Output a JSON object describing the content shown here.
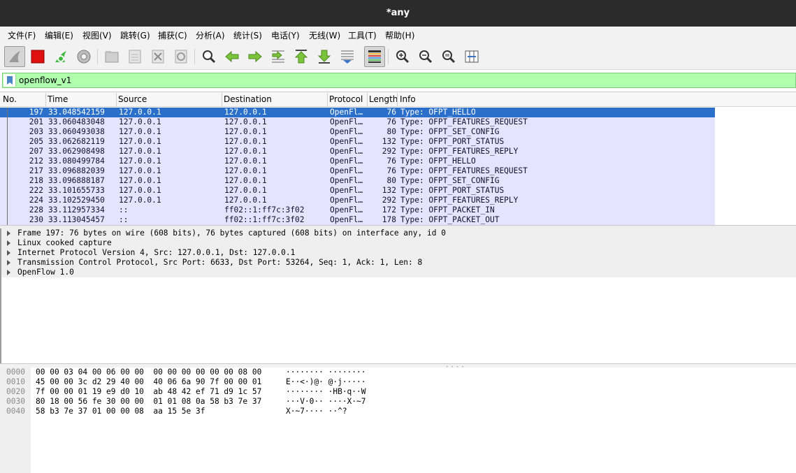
{
  "window": {
    "title": "*any"
  },
  "menu": [
    {
      "label": "文件(F)"
    },
    {
      "label": "编辑(E)"
    },
    {
      "label": "视图(V)"
    },
    {
      "label": "跳转(G)"
    },
    {
      "label": "捕获(C)"
    },
    {
      "label": "分析(A)"
    },
    {
      "label": "统计(S)"
    },
    {
      "label": "电话(Y)"
    },
    {
      "label": "无线(W)"
    },
    {
      "label": "工具(T)"
    },
    {
      "label": "帮助(H)"
    }
  ],
  "toolbar": {
    "icons": [
      "shark-fin-icon",
      "stop-capture-icon",
      "restart-capture-icon",
      "capture-options-icon",
      "open-file-icon",
      "save-file-icon",
      "close-file-icon",
      "reload-icon",
      "find-packet-icon",
      "go-back-icon",
      "go-forward-icon",
      "go-to-packet-icon",
      "go-first-icon",
      "go-last-icon",
      "auto-scroll-icon",
      "colorize-icon",
      "zoom-in-icon",
      "zoom-out-icon",
      "normal-size-icon",
      "resize-columns-icon"
    ]
  },
  "filter": {
    "value": "openflow_v1"
  },
  "packet_list": {
    "columns": [
      "No.",
      "Time",
      "Source",
      "Destination",
      "Protocol",
      "Length",
      "Info"
    ],
    "rows": [
      {
        "no": "197",
        "time": "33.048542159",
        "src": "127.0.0.1",
        "dst": "127.0.0.1",
        "proto": "OpenFl…",
        "len": "76",
        "info": "Type: OFPT_HELLO",
        "selected": true
      },
      {
        "no": "201",
        "time": "33.060483048",
        "src": "127.0.0.1",
        "dst": "127.0.0.1",
        "proto": "OpenFl…",
        "len": "76",
        "info": "Type: OFPT_FEATURES_REQUEST"
      },
      {
        "no": "203",
        "time": "33.060493038",
        "src": "127.0.0.1",
        "dst": "127.0.0.1",
        "proto": "OpenFl…",
        "len": "80",
        "info": "Type: OFPT_SET_CONFIG"
      },
      {
        "no": "205",
        "time": "33.062682119",
        "src": "127.0.0.1",
        "dst": "127.0.0.1",
        "proto": "OpenFl…",
        "len": "132",
        "info": "Type: OFPT_PORT_STATUS"
      },
      {
        "no": "207",
        "time": "33.062908498",
        "src": "127.0.0.1",
        "dst": "127.0.0.1",
        "proto": "OpenFl…",
        "len": "292",
        "info": "Type: OFPT_FEATURES_REPLY"
      },
      {
        "no": "212",
        "time": "33.080499784",
        "src": "127.0.0.1",
        "dst": "127.0.0.1",
        "proto": "OpenFl…",
        "len": "76",
        "info": "Type: OFPT_HELLO"
      },
      {
        "no": "217",
        "time": "33.096882039",
        "src": "127.0.0.1",
        "dst": "127.0.0.1",
        "proto": "OpenFl…",
        "len": "76",
        "info": "Type: OFPT_FEATURES_REQUEST"
      },
      {
        "no": "218",
        "time": "33.096888187",
        "src": "127.0.0.1",
        "dst": "127.0.0.1",
        "proto": "OpenFl…",
        "len": "80",
        "info": "Type: OFPT_SET_CONFIG"
      },
      {
        "no": "222",
        "time": "33.101655733",
        "src": "127.0.0.1",
        "dst": "127.0.0.1",
        "proto": "OpenFl…",
        "len": "132",
        "info": "Type: OFPT_PORT_STATUS"
      },
      {
        "no": "224",
        "time": "33.102529450",
        "src": "127.0.0.1",
        "dst": "127.0.0.1",
        "proto": "OpenFl…",
        "len": "292",
        "info": "Type: OFPT_FEATURES_REPLY"
      },
      {
        "no": "228",
        "time": "33.112957334",
        "src": "::",
        "dst": "ff02::1:ff7c:3f02",
        "proto": "OpenFl…",
        "len": "172",
        "info": "Type: OFPT_PACKET_IN"
      },
      {
        "no": "230",
        "time": "33.113045457",
        "src": "::",
        "dst": "ff02::1:ff7c:3f02",
        "proto": "OpenFl…",
        "len": "178",
        "info": "Type: OFPT_PACKET_OUT"
      }
    ]
  },
  "details": [
    {
      "text": "Frame 197: 76 bytes on wire (608 bits), 76 bytes captured (608 bits) on interface any, id 0"
    },
    {
      "text": "Linux cooked capture"
    },
    {
      "text": "Internet Protocol Version 4, Src: 127.0.0.1, Dst: 127.0.0.1"
    },
    {
      "text": "Transmission Control Protocol, Src Port: 6633, Dst Port: 53264, Seq: 1, Ack: 1, Len: 8"
    },
    {
      "text": "OpenFlow 1.0"
    }
  ],
  "bytes": [
    {
      "offset": "0000",
      "hex": "00 00 03 04 00 06 00 00  00 00 00 00 00 00 08 00",
      "ascii": "········ ········"
    },
    {
      "offset": "0010",
      "hex": "45 00 00 3c d2 29 40 00  40 06 6a 90 7f 00 00 01",
      "ascii": "E··<·)@· @·j·····"
    },
    {
      "offset": "0020",
      "hex": "7f 00 00 01 19 e9 d0 10  ab 48 42 ef 71 d9 1c 57",
      "ascii": "········ ·HB·q··W"
    },
    {
      "offset": "0030",
      "hex": "80 18 00 56 fe 30 00 00  01 01 08 0a 58 b3 7e 37",
      "ascii": "···V·0·· ····X·~7"
    },
    {
      "offset": "0040",
      "hex": "58 b3 7e 37 01 00 00 08  aa 15 5e 3f",
      "ascii": "X·~7···· ··^?"
    }
  ]
}
